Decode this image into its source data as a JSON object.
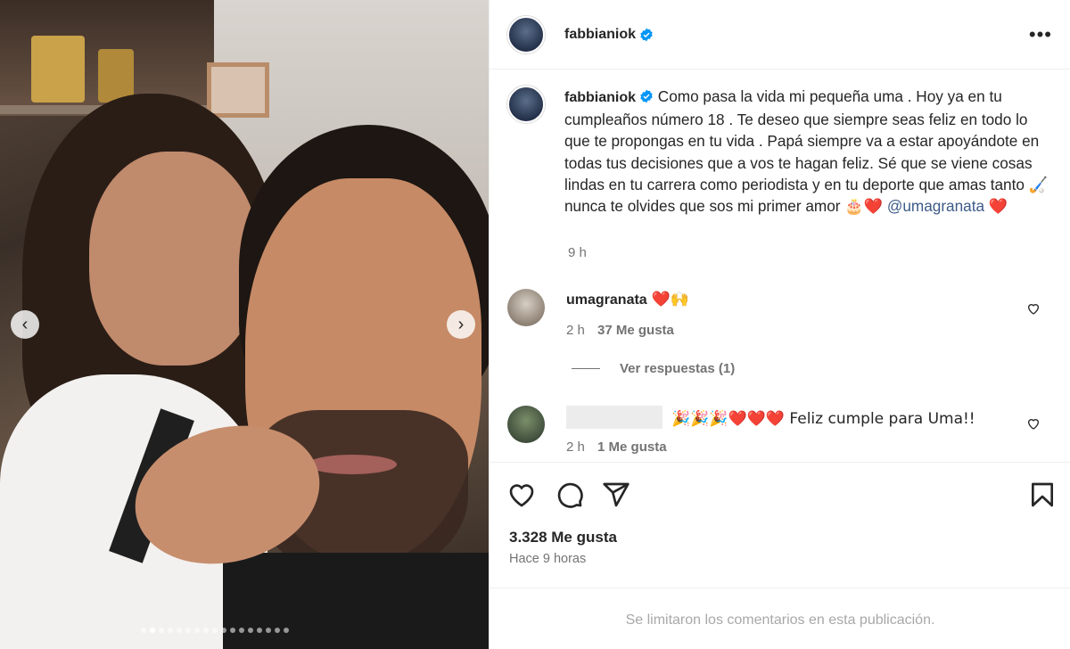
{
  "post": {
    "username": "fabbianiok",
    "caption": "Como pasa la vida mi pequeña uma . Hoy ya en tu cumpleaños número 18 . Te deseo que siempre seas feliz en todo lo que te propongas en tu vida . Papá siempre va a estar apoyándote en todas tus decisiones que a vos te hagan feliz. Sé que se viene cosas lindas en tu carrera como periodista y en tu deporte que amas tanto 🏑 nunca te olvides que sos mi primer amor 🎂❤️",
    "mention": "@umagranata",
    "caption_end": "❤️",
    "caption_time": "9 h",
    "likes": "3.328 Me gusta",
    "posted_ago": "Hace 9 horas",
    "comments_limited": "Se limitaron los comentarios en esta publicación."
  },
  "comments": [
    {
      "username": "umagranata",
      "text": "❤️🙌",
      "time": "2 h",
      "likes": "37 Me gusta",
      "replies_label": "Ver respuestas (1)"
    },
    {
      "username": "",
      "text": "🎉🎉🎉❤️❤️❤️ Feliz cumple para Uma!!",
      "time": "2 h",
      "likes": "1 Me gusta"
    }
  ],
  "carousel": {
    "total_dots": 17,
    "active_index": 1
  },
  "icons": {
    "verified": "verified-badge-icon",
    "more": "more-options-icon",
    "like": "heart-icon",
    "comment": "comment-icon",
    "share": "send-icon",
    "save": "bookmark-icon",
    "prev": "chevron-left-icon",
    "next": "chevron-right-icon"
  },
  "colors": {
    "verified": "#0095f6",
    "mention": "#3c5a88",
    "secondary_text": "#737373"
  }
}
